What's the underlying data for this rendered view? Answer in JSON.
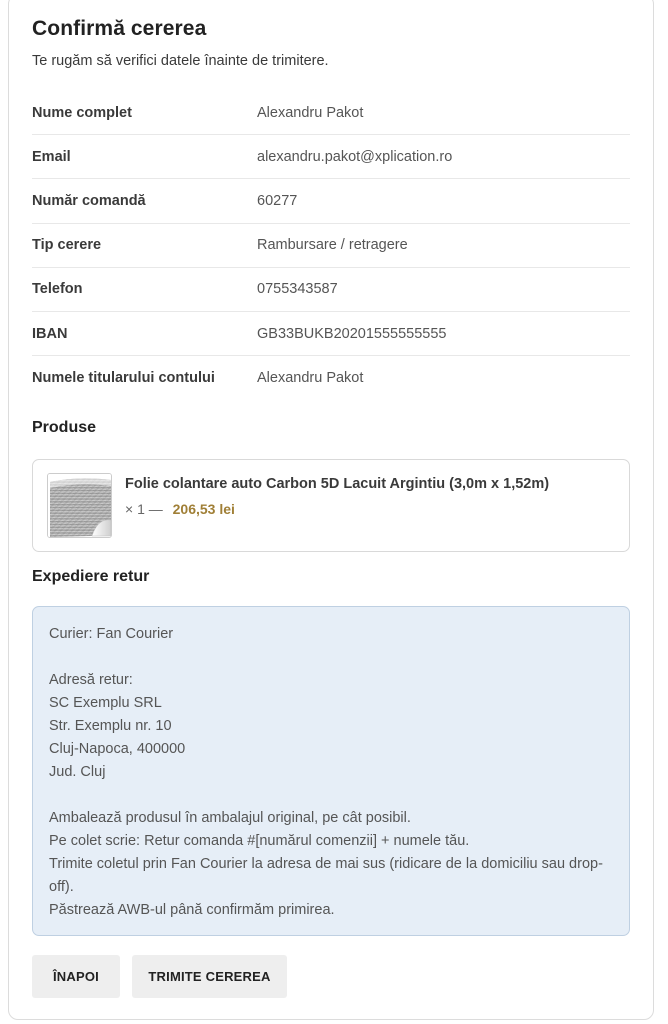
{
  "header": {
    "title": "Confirmă cererea",
    "subtitle": "Te rugăm să verifici datele înainte de trimitere."
  },
  "details": [
    {
      "label": "Nume complet",
      "value": "Alexandru Pakot"
    },
    {
      "label": "Email",
      "value": "alexandru.pakot@xplication.ro"
    },
    {
      "label": "Număr comandă",
      "value": "60277"
    },
    {
      "label": "Tip cerere",
      "value": "Rambursare / retragere"
    },
    {
      "label": "Telefon",
      "value": "0755343587"
    },
    {
      "label": "IBAN",
      "value": "GB33BUKB20201555555555"
    },
    {
      "label": "Numele titularului contului",
      "value": "Alexandru Pakot"
    }
  ],
  "products": {
    "title": "Produse",
    "items": [
      {
        "name": "Folie colantare auto Carbon 5D Lacuit Argintiu (3,0m x 1,52m)",
        "qty": "× 1 —",
        "price": "206,53 lei"
      }
    ]
  },
  "shipping": {
    "title": "Expediere retur",
    "courier": "Curier: Fan Courier",
    "address_label": "Adresă retur:",
    "address_lines": [
      "SC Exemplu SRL",
      "Str. Exemplu nr. 10",
      "Cluj-Napoca, 400000",
      "Jud. Cluj"
    ],
    "instructions": [
      "Ambalează produsul în ambalajul original, pe cât posibil.",
      "Pe colet scrie: Retur comanda #[numărul comenzii] + numele tău.",
      "Trimite coletul prin Fan Courier la adresa de mai sus (ridicare de la domiciliu sau drop-off).",
      "Păstrează AWB-ul până confirmăm primirea."
    ]
  },
  "actions": {
    "back_label": "ÎNAPOI",
    "submit_label": "TRIMITE CEREREA"
  }
}
